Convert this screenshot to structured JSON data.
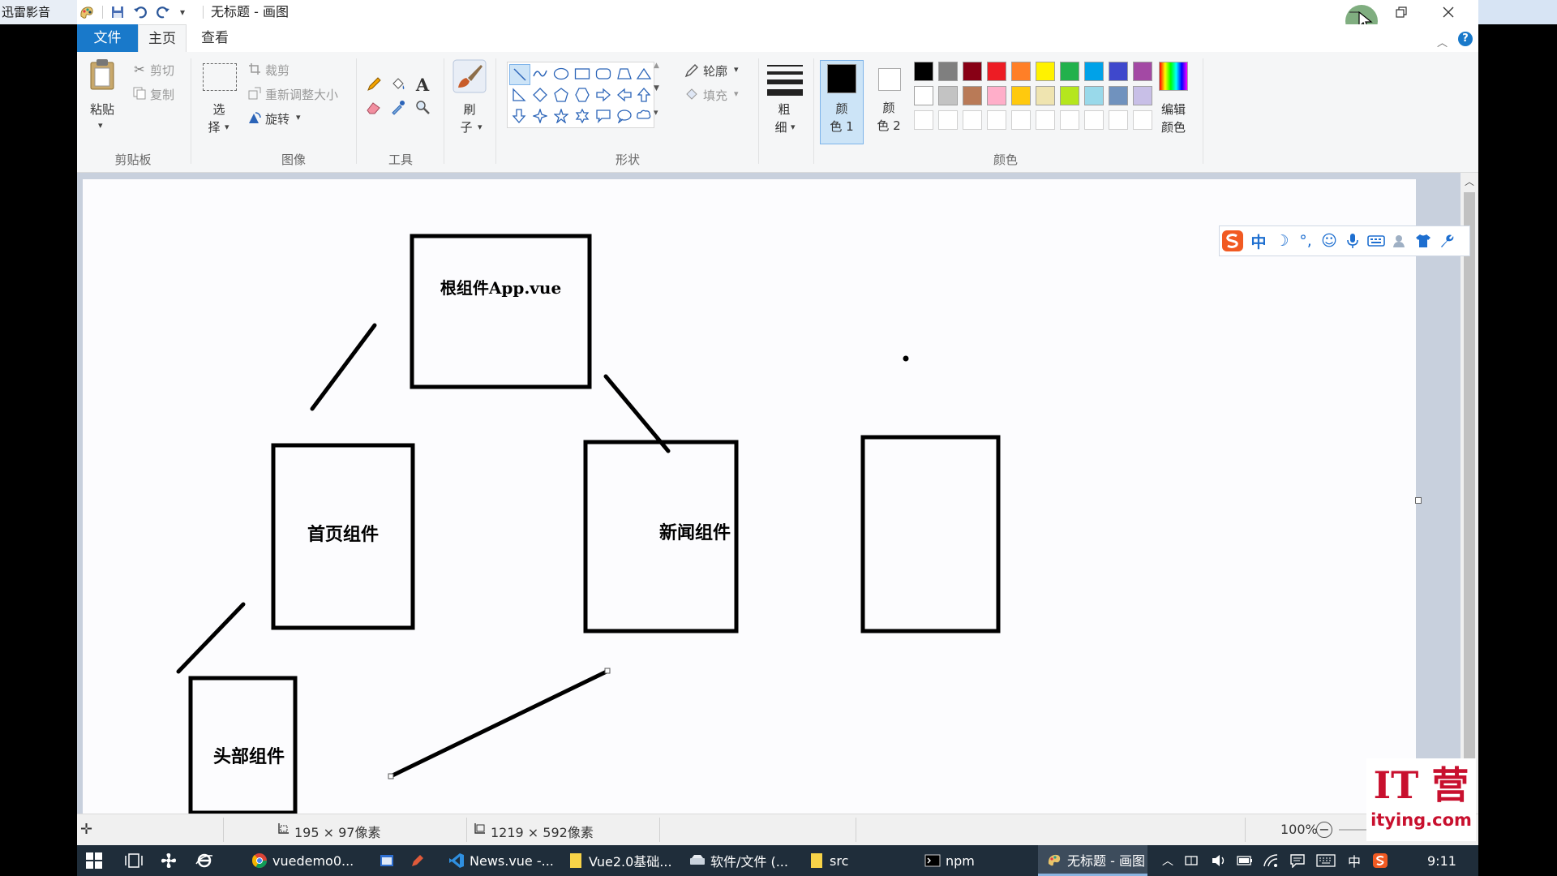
{
  "outer": {
    "xunlei_label": "迅雷影音"
  },
  "titlebar": {
    "title": "无标题 - 画图"
  },
  "tabs": [
    {
      "label": "文件"
    },
    {
      "label": "主页"
    },
    {
      "label": "查看"
    }
  ],
  "ribbon": {
    "clipboard": {
      "paste": "粘贴",
      "cut": "剪切",
      "copy": "复制",
      "group": "剪贴板"
    },
    "image": {
      "select_top": "选",
      "select_bottom": "择",
      "crop": "裁剪",
      "resize": "重新调整大小",
      "rotate": "旋转",
      "group": "图像"
    },
    "tools": {
      "group": "工具"
    },
    "brush": {
      "top": "刷",
      "bottom": "子"
    },
    "shapes": {
      "outline": "轮廓",
      "fill": "填充",
      "group": "形状"
    },
    "size": {
      "top": "粗",
      "bottom": "细"
    },
    "color1": {
      "top": "颜",
      "bottom": "色 1"
    },
    "color2": {
      "top": "颜",
      "bottom": "色 2"
    },
    "colors": {
      "group": "颜色",
      "edit_top": "编辑",
      "edit_bottom": "颜色"
    }
  },
  "palette": {
    "row1": [
      "#000000",
      "#7f7f7f",
      "#880015",
      "#ed1c24",
      "#ff7f27",
      "#fff200",
      "#22b14c",
      "#00a2e8",
      "#3f48cc",
      "#a349a4"
    ],
    "row2": [
      "#ffffff",
      "#c3c3c3",
      "#b97a57",
      "#ffaec9",
      "#ffc90e",
      "#efe4b0",
      "#b5e61d",
      "#99d9ea",
      "#7092be",
      "#c8bfe7"
    ],
    "color1": "#000000",
    "color2": "#ffffff"
  },
  "canvas": {
    "root_box": "根组件App.vue",
    "home_box": "首页组件",
    "news_box": "新闻组件",
    "header_box": "头部组件"
  },
  "status": {
    "selection_size": "195 × 97像素",
    "canvas_size": "1219 × 592像素",
    "zoom": "100%"
  },
  "ime": {
    "lang": "中"
  },
  "watermark": {
    "brand": "IT 营",
    "site": "itying.com"
  },
  "taskbar": {
    "items": [
      {
        "label": "vuedemo0..."
      },
      {
        "label": "News.vue -..."
      },
      {
        "label": "Vue2.0基础..."
      },
      {
        "label": "软件/文件 (..."
      },
      {
        "label": "src"
      },
      {
        "label": "npm"
      },
      {
        "label": "无标题 - 画图"
      }
    ],
    "ime_lang": "中",
    "time": "9:11"
  }
}
